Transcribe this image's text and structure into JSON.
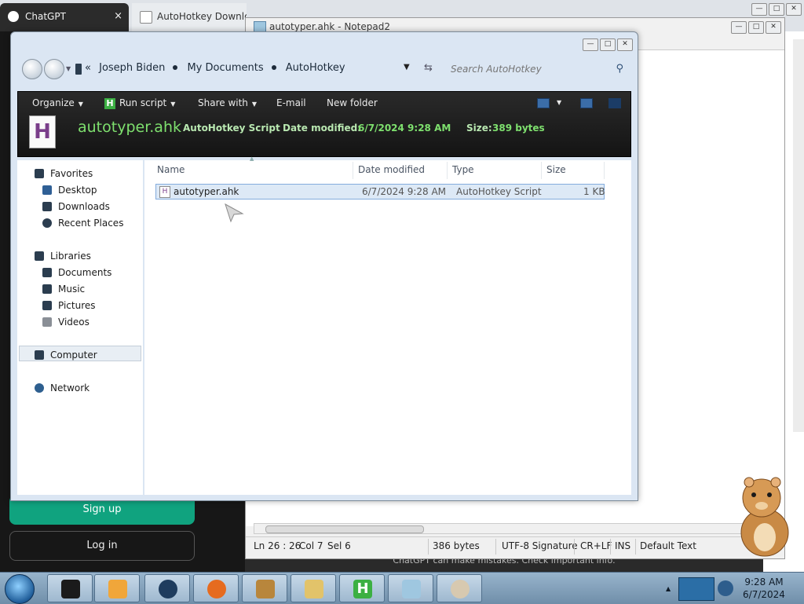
{
  "browser": {
    "tabs": [
      {
        "label": "ChatGPT",
        "close": "×"
      },
      {
        "label": "AutoHotkey Downlo"
      }
    ],
    "sidebar": {
      "signup_label": "Sign up",
      "login_label": "Log in"
    },
    "footer_note": "ChatGPT can make mistakes. Check important info."
  },
  "notepad": {
    "title": "autotyper.ahk - Notepad2",
    "status": {
      "position": "Ln 26 : 26",
      "col": "Col 7",
      "sel": "Sel 6",
      "size": "386 bytes",
      "encoding": "UTF-8 Signature",
      "eol": "CR+LF",
      "mode": "INS",
      "scheme": "Default Text"
    }
  },
  "explorer": {
    "breadcrumb": {
      "prefix": "«",
      "items": [
        "Joseph Biden",
        "My Documents",
        "AutoHotkey"
      ]
    },
    "search_placeholder": "Search AutoHotkey",
    "toolbar": {
      "organize": "Organize",
      "run_script": "Run script",
      "share_with": "Share with",
      "email": "E-mail",
      "new_folder": "New folder"
    },
    "details": {
      "filename": "autotyper.ahk",
      "type": "AutoHotkey Script",
      "date_label": "Date modified:",
      "date_value": "6/7/2024 9:28 AM",
      "size_label": "Size:",
      "size_value": "389 bytes"
    },
    "nav": {
      "favorites": "Favorites",
      "desktop": "Desktop",
      "downloads": "Downloads",
      "recent_places": "Recent Places",
      "libraries": "Libraries",
      "documents": "Documents",
      "music": "Music",
      "pictures": "Pictures",
      "videos": "Videos",
      "computer": "Computer",
      "network": "Network"
    },
    "columns": {
      "name": "Name",
      "date_modified": "Date modified",
      "type": "Type",
      "size": "Size"
    },
    "files": [
      {
        "name": "autotyper.ahk",
        "date_modified": "6/7/2024 9:28 AM",
        "type": "AutoHotkey Script",
        "size": "1 KB"
      }
    ]
  },
  "taskbar": {
    "time": "9:28 AM",
    "date": "6/7/2024",
    "apps": [
      "media-player-icon",
      "globe-icon",
      "firefox-icon",
      "box-game-icon",
      "file-manager-icon",
      "autohotkey-icon",
      "notepad-icon",
      "paint-icon"
    ]
  },
  "colors": {
    "explorer_frame": "#dbe6f3",
    "toolbar_bg": "#1e1e1e",
    "details_accent": "#7ee06e",
    "chatgpt_green": "#10a37f"
  }
}
